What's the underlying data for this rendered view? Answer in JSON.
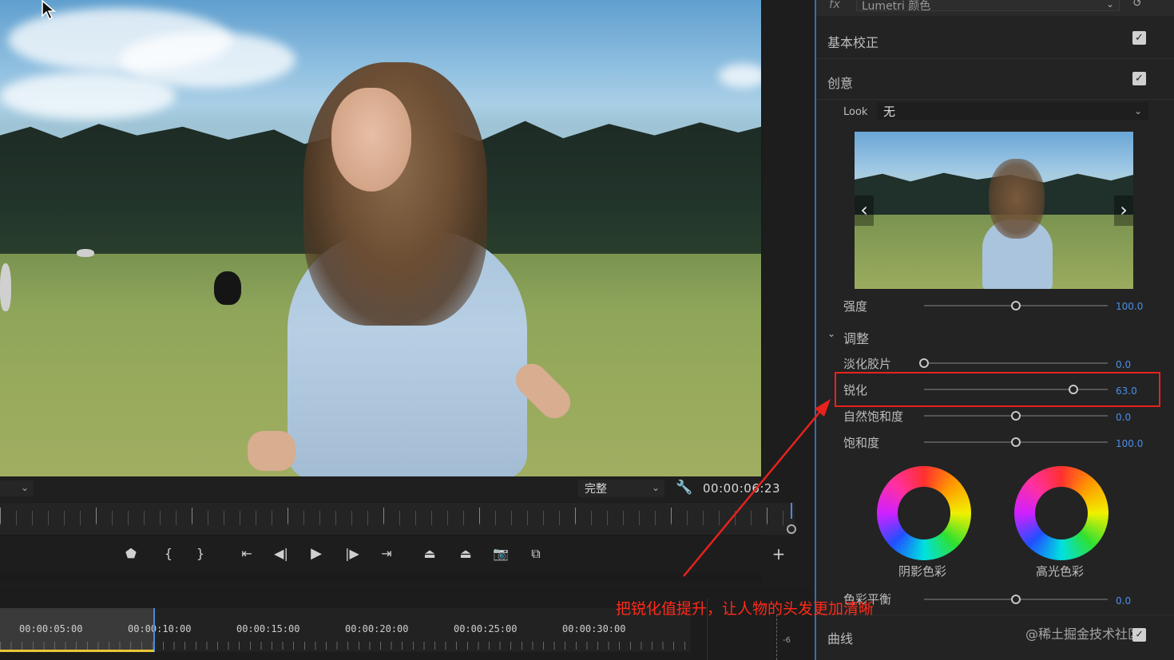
{
  "colors": {
    "accent_blue": "#4a8fe8",
    "annotation_red": "#e8221c",
    "panel_bg": "#232323",
    "work_area_yellow": "#e8c536"
  },
  "monitor": {
    "quality_select": "完整",
    "timecode": "00:00:06:23",
    "transport_icons": [
      "add-marker-icon",
      "mark-in-icon",
      "mark-out-icon",
      "go-to-in-icon",
      "step-back-icon",
      "play-icon",
      "step-forward-icon",
      "go-to-out-icon",
      "lift-icon",
      "extract-icon",
      "export-frame-icon",
      "comparison-view-icon",
      "add-button-icon"
    ]
  },
  "timeline": {
    "ruler_labels": [
      "00:00:05:00",
      "00:00:10:00",
      "00:00:15:00",
      "00:00:20:00",
      "00:00:25:00",
      "00:00:30:00"
    ],
    "audio_meter_label": "-6"
  },
  "lumetri": {
    "header_effect": "Lumetri 颜色",
    "sections": {
      "basic": {
        "label": "基本校正",
        "checked": true
      },
      "creative": {
        "label": "创意",
        "checked": true
      },
      "curves": {
        "label": "曲线",
        "checked": true
      }
    },
    "look": {
      "label": "Look",
      "value": "无"
    },
    "intensity": {
      "label": "强度",
      "value": "100.0",
      "level": 0.5
    },
    "adjust": {
      "label": "调整",
      "sliders": [
        {
          "label": "淡化胶片",
          "value": "0.0",
          "level": 0.0
        },
        {
          "label": "锐化",
          "value": "63.0",
          "level": 0.815
        },
        {
          "label": "自然饱和度",
          "value": "0.0",
          "level": 0.5
        },
        {
          "label": "饱和度",
          "value": "100.0",
          "level": 0.5
        }
      ]
    },
    "wheels": {
      "shadow": "阴影色彩",
      "highlight": "高光色彩"
    },
    "color_balance": {
      "label": "色彩平衡",
      "value": "0.0",
      "level": 0.5
    }
  },
  "annotation": {
    "text": "把锐化值提升，让人物的头发更加清晰"
  },
  "watermark": "@稀土掘金技术社区"
}
